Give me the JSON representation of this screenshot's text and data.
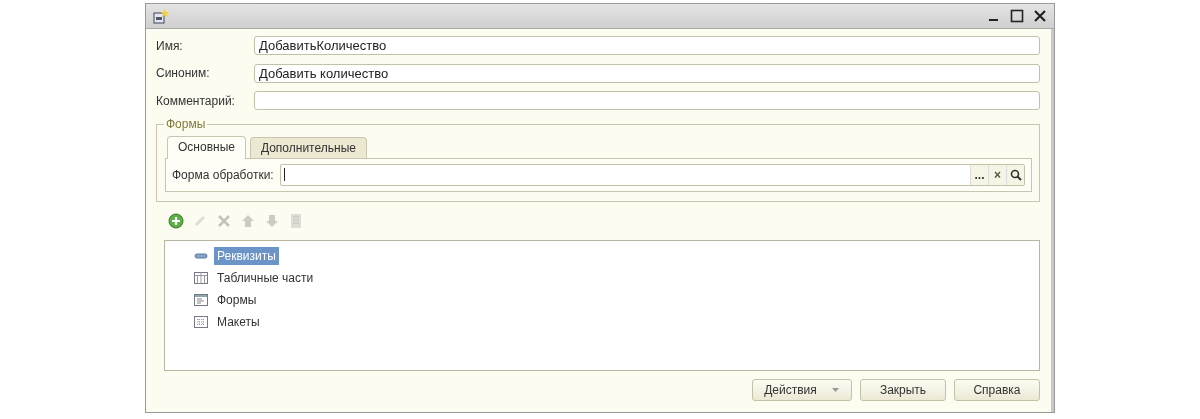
{
  "fields": [
    {
      "label": "Имя:",
      "value": "ДобавитьКоличество"
    },
    {
      "label": "Синоним:",
      "value": "Добавить количество"
    },
    {
      "label": "Комментарий:"
    }
  ],
  "forms_group": {
    "title": "Формы",
    "tabs": [
      {
        "label": "Основные",
        "selected": true
      },
      {
        "label": "Дополнительные",
        "selected": false
      }
    ],
    "field": {
      "label": "Форма обработки:",
      "buttons": [
        "...",
        "×"
      ]
    }
  },
  "toolbar": [
    {
      "kind": "add",
      "disabled": false
    },
    {
      "kind": "edit",
      "disabled": true
    },
    {
      "kind": "delete",
      "disabled": true
    },
    {
      "kind": "up",
      "disabled": true
    },
    {
      "kind": "down",
      "disabled": true
    },
    {
      "kind": "sort",
      "disabled": true
    }
  ],
  "tree": [
    {
      "kind": "attribute",
      "label": "Реквизиты",
      "selected": true
    },
    {
      "kind": "table",
      "label": "Табличные части",
      "selected": false
    },
    {
      "kind": "form",
      "label": "Формы",
      "selected": false
    },
    {
      "kind": "template",
      "label": "Макеты",
      "selected": false
    }
  ],
  "buttons": [
    {
      "label": "Действия",
      "dropdown": true
    },
    {
      "label": "Закрыть",
      "dropdown": false
    },
    {
      "label": "Справка",
      "dropdown": false
    }
  ]
}
